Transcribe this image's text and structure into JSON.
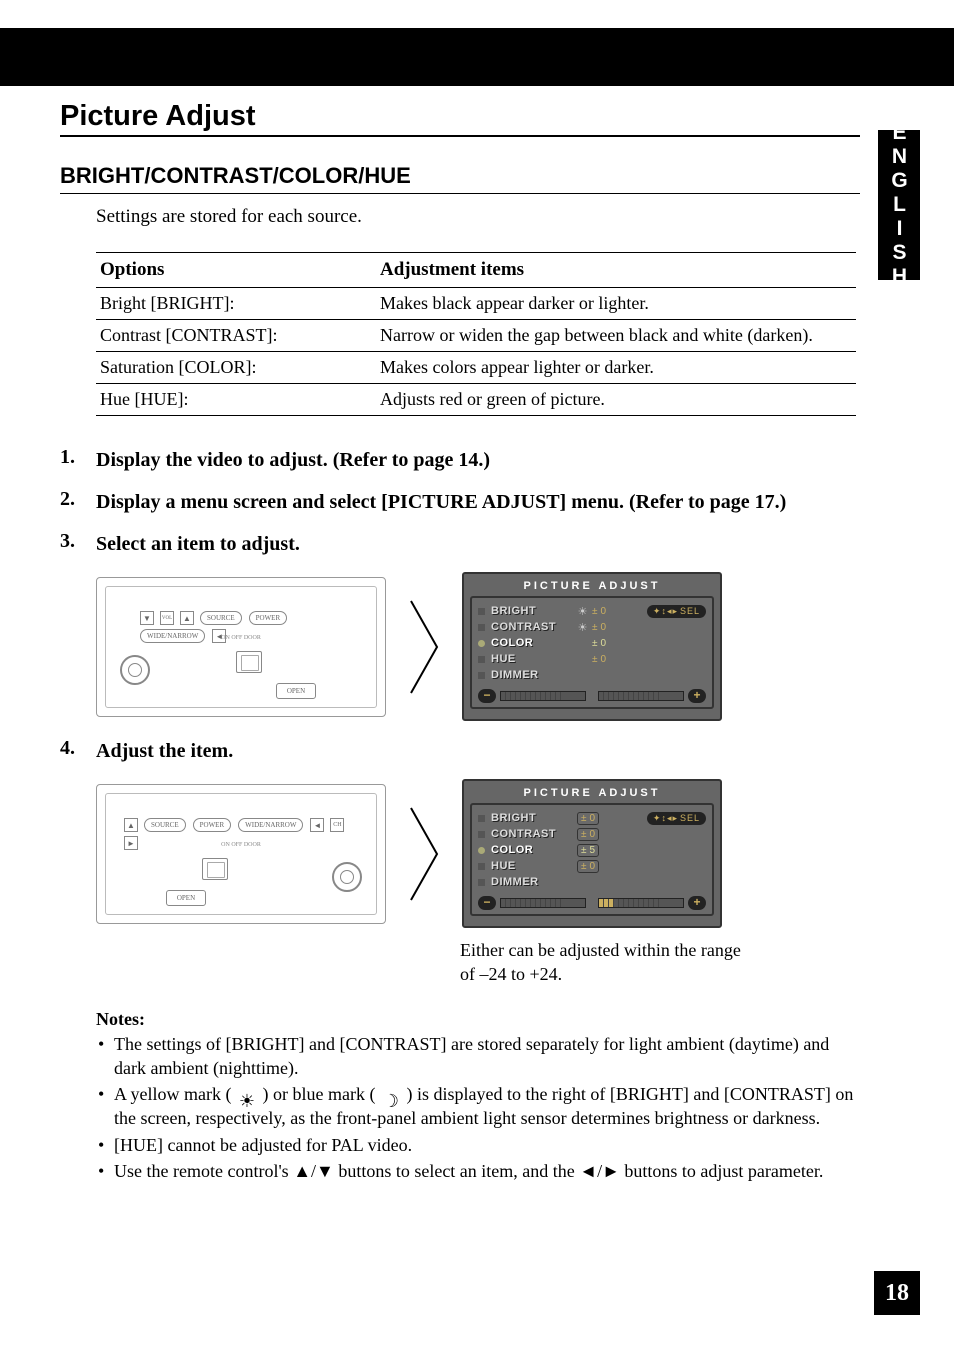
{
  "side_tab": "ENGLISH",
  "page_number": "18",
  "section_title": "Picture Adjust",
  "subsection_title": "BRIGHT/CONTRAST/COLOR/HUE",
  "intro": "Settings are stored for each source.",
  "table": {
    "head_options": "Options",
    "head_items": "Adjustment items",
    "rows": [
      {
        "opt": "Bright [BRIGHT]:",
        "desc": "Makes black appear darker or lighter."
      },
      {
        "opt": "Contrast [CONTRAST]:",
        "desc": "Narrow or widen the gap between black and white (darken)."
      },
      {
        "opt": "Saturation [COLOR]:",
        "desc": "Makes colors appear lighter or darker."
      },
      {
        "opt": "Hue [HUE]:",
        "desc": "Adjusts red or green of picture."
      }
    ]
  },
  "steps": {
    "s1": {
      "num": "1.",
      "text": "Display the video to adjust. (Refer to page 14.)"
    },
    "s2": {
      "num": "2.",
      "text": "Display a menu screen and select [PICTURE ADJUST] menu. (Refer to page 17.)"
    },
    "s3": {
      "num": "3.",
      "text": "Select an item to adjust."
    },
    "s4": {
      "num": "4.",
      "text": "Adjust the item."
    }
  },
  "device": {
    "btn_source": "SOURCE",
    "btn_power": "POWER",
    "btn_widenarrow": "WIDE/NARROW",
    "btn_open": "OPEN",
    "switch_label": "ON OFF DOOR"
  },
  "osd": {
    "title": "PICTURE ADJUST",
    "sel_badge": "SEL",
    "items": {
      "bright": "BRIGHT",
      "contrast": "CONTRAST",
      "color": "COLOR",
      "hue": "HUE",
      "dimmer": "DIMMER"
    },
    "vals_a": {
      "bright_pm": "±",
      "bright_v": "0",
      "contrast_pm": "±",
      "contrast_v": "0",
      "color_pm": "±",
      "color_v": "0",
      "hue_pm": "±",
      "hue_v": "0"
    },
    "vals_b": {
      "bright_pm": "±",
      "bright_v": "0",
      "contrast_pm": "±",
      "contrast_v": "0",
      "color_pm": "±",
      "color_v": "5",
      "hue_pm": "±",
      "hue_v": "0"
    }
  },
  "range_note_l1": "Either can be adjusted within the range",
  "range_note_l2": "of –24 to +24.",
  "notes": {
    "title": "Notes:",
    "n1": "The settings of [BRIGHT] and [CONTRAST] are stored separately for light ambient (daytime) and dark ambient (nighttime).",
    "n2a": "A yellow mark (",
    "n2b": ") or blue mark (",
    "n2c": ") is displayed to the right of [BRIGHT] and [CONTRAST] on the screen, respectively, as the front-panel ambient light sensor determines brightness or darkness.",
    "n3": "[HUE] cannot be adjusted for PAL video.",
    "n4": "Use the remote control's ▲/▼ buttons to select an item, and the ◄/► buttons to adjust parameter."
  }
}
